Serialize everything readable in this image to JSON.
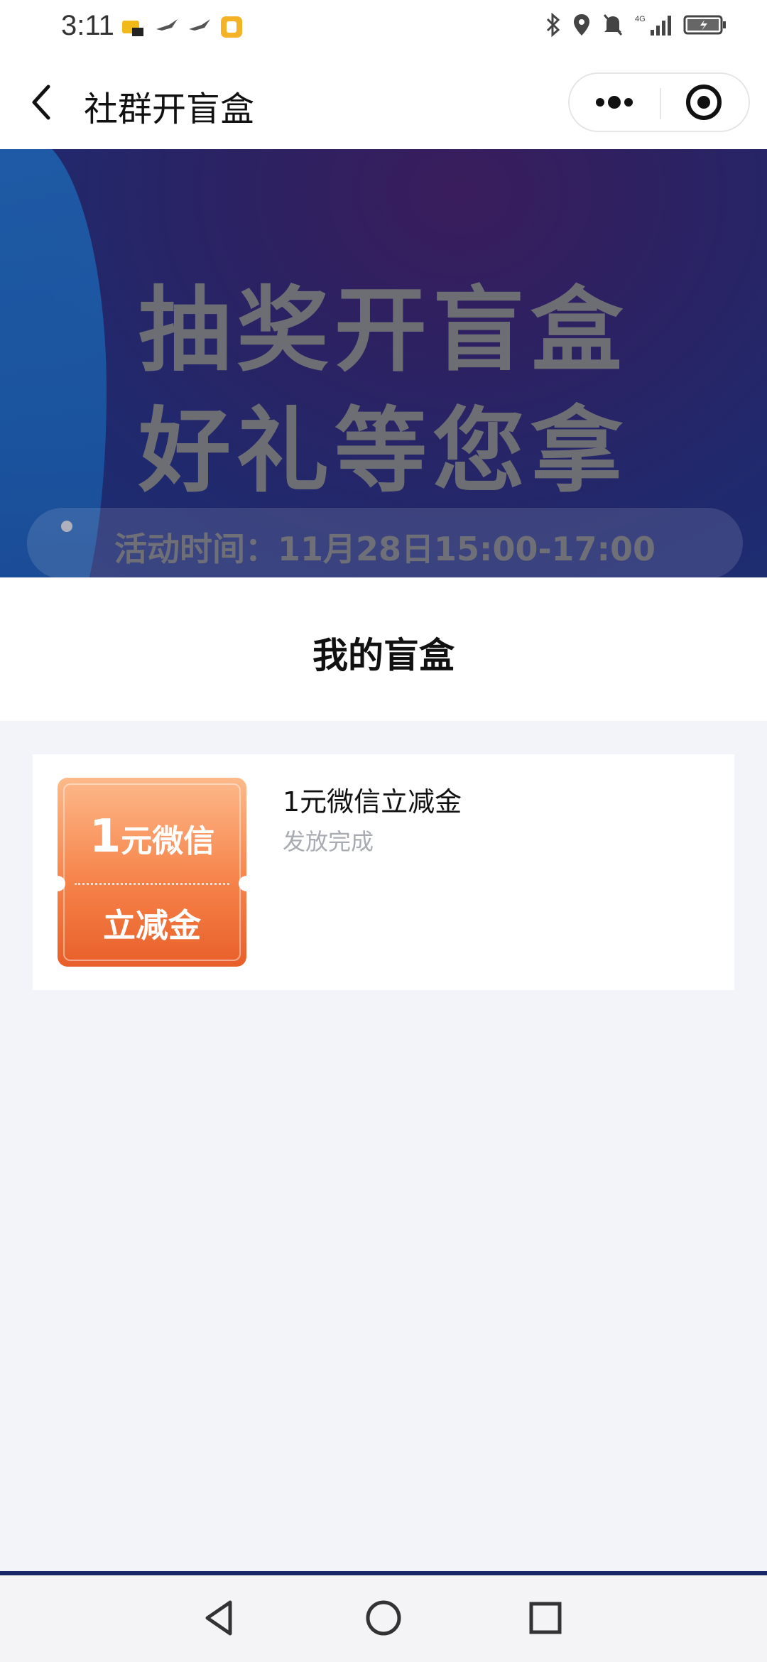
{
  "status_bar": {
    "time": "3:11",
    "left_icons": [
      "notification-icon",
      "bird-icon",
      "bird-icon",
      "app-icon"
    ],
    "right_icons": [
      "bluetooth-icon",
      "location-icon",
      "mute-icon",
      "signal-4g-icon",
      "battery-icon"
    ]
  },
  "header": {
    "title": "社群开盲盒"
  },
  "banner": {
    "line1": "抽奖开盲盒",
    "line2": "好礼等您拿",
    "time_text": "活动时间：11月28日15:00-17:00"
  },
  "section": {
    "title": "我的盲盒"
  },
  "prize": {
    "coupon_amount": "1",
    "coupon_line1_rest": "元微信",
    "coupon_line2": "立减金",
    "name": "1元微信立减金",
    "status": "发放完成"
  },
  "colors": {
    "coupon_top": "#fdb98a",
    "coupon_bottom": "#e85f2a",
    "banner_dark": "#1f2a6e",
    "status_gray": "#a9abb3"
  }
}
